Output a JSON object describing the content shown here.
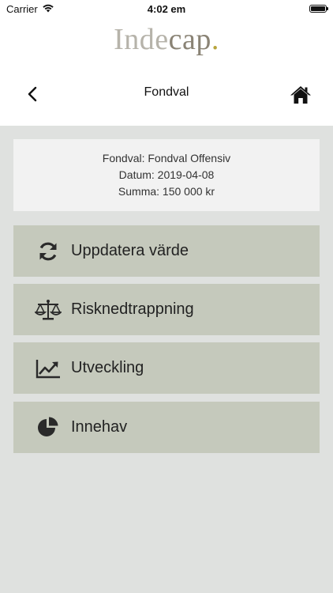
{
  "status_bar": {
    "carrier": "Carrier",
    "time": "4:02 em"
  },
  "header": {
    "logo_part1": "Inde",
    "logo_part2": "cap",
    "logo_dot": ".",
    "title": "Fondval"
  },
  "info": {
    "fondval": "Fondval: Fondval Offensiv",
    "datum": "Datum: 2019-04-08",
    "summa": "Summa: 150 000 kr"
  },
  "menu": {
    "items": [
      {
        "label": "Uppdatera värde",
        "icon": "refresh-icon"
      },
      {
        "label": "Risknedtrappning",
        "icon": "scale-icon"
      },
      {
        "label": "Utveckling",
        "icon": "line-chart-icon"
      },
      {
        "label": "Innehav",
        "icon": "pie-chart-icon"
      }
    ]
  },
  "colors": {
    "background": "#dfe1df",
    "menu_item": "#c5c9bc",
    "info_card": "#f2f2f2",
    "logo_dot": "#b7a43b"
  }
}
